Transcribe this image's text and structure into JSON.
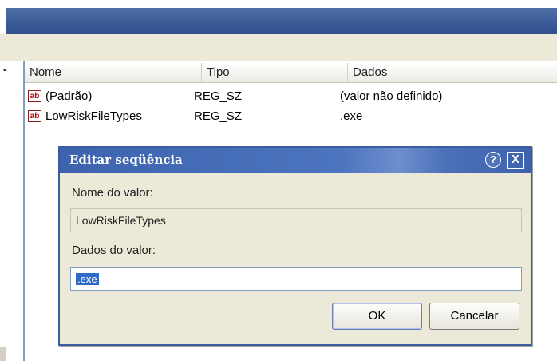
{
  "list": {
    "columns": [
      "Nome",
      "Tipo",
      "Dados"
    ],
    "rows": [
      {
        "icon": "string-value-icon",
        "icon_text": "ab",
        "name": "(Padrão)",
        "type": "REG_SZ",
        "data": "(valor não definido)"
      },
      {
        "icon": "string-value-icon",
        "icon_text": "ab",
        "name": "LowRiskFileTypes",
        "type": "REG_SZ",
        "data": ".exe"
      }
    ]
  },
  "dialog": {
    "title": "Editar seqüência",
    "help_glyph": "?",
    "close_glyph": "X",
    "value_name_label": "Nome do valor:",
    "value_name": "LowRiskFileTypes",
    "value_data_label": "Dados do valor:",
    "value_data": ".exe",
    "ok_label": "OK",
    "cancel_label": "Cancelar"
  },
  "colors": {
    "titlebar": "#3a5a96",
    "dialog_title": "#3d63ae",
    "selection": "#316ac5",
    "face": "#ece9d8"
  }
}
